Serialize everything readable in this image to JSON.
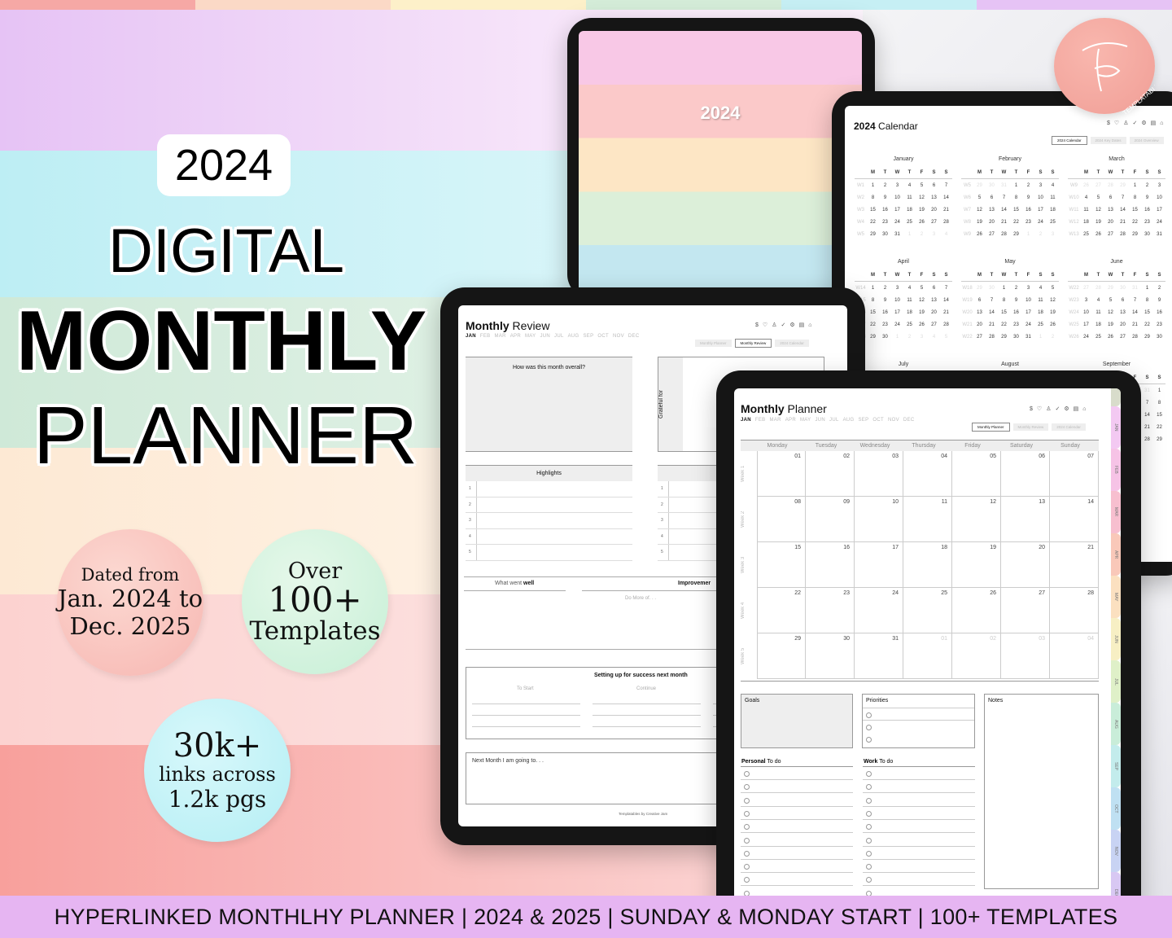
{
  "colors": {
    "purple": "#e6c3f5",
    "cyan": "#bdeef4",
    "green": "#d7eede",
    "peach": "#fdf0df",
    "pink": "#fcd6d4",
    "salmon": "#f8a9a5",
    "footer": "#e6b5f2"
  },
  "hero": {
    "year": "2024",
    "line1": "DIGITAL",
    "line2": "MONTHLY",
    "line3": "PLANNER"
  },
  "badges": {
    "dated": {
      "l1": "Dated from",
      "l2": "Jan. 2024 to",
      "l3": "Dec. 2025"
    },
    "templates": {
      "l1": "Over",
      "l2": "100+",
      "l3": "Templates"
    },
    "links": {
      "l1": "30k+",
      "l2": "links across",
      "l3": "1.2k pgs"
    }
  },
  "cover": {
    "year": "2024"
  },
  "logo": {
    "text": "TEMPLATABLES",
    "mark": "TF"
  },
  "nav": {
    "months": [
      "JAN",
      "FEB",
      "MAR",
      "APR",
      "MAY",
      "JUN",
      "JUL",
      "AUG",
      "SEP",
      "OCT",
      "NOV",
      "DEC"
    ],
    "icons": [
      "dollar-icon",
      "heart-icon",
      "person-icon",
      "check-circle-icon",
      "settings-icon",
      "book-icon",
      "home-icon"
    ]
  },
  "calendar": {
    "title_bold": "2024",
    "title_rest": " Calendar",
    "buttons": [
      "2024 Calendar",
      "2024 Key Dates",
      "2024 Overview"
    ],
    "weekdays": [
      "M",
      "T",
      "W",
      "T",
      "F",
      "S",
      "S"
    ],
    "months": [
      "January",
      "February",
      "March",
      "April",
      "May",
      "June",
      "July",
      "August",
      "September"
    ]
  },
  "review": {
    "title_bold": "Monthly",
    "title_rest": " Review",
    "buttons": [
      "Monthly Planner",
      "Monthly Review",
      "2024 Calendar"
    ],
    "overall": "How was this month overall?",
    "grateful": "Grateful for",
    "highlights": "Highlights",
    "numbers": [
      "1",
      "2",
      "3",
      "4",
      "5"
    ],
    "went_well_a": "What went ",
    "went_well_b": "well",
    "improvements": "Improvemer",
    "do_more": "Do More of. . .",
    "success": "Setting up for success next month",
    "to_start": "To Start",
    "continue": "Continue",
    "next_month": "Next Month I am going to. . .",
    "credit": "Templatables by Creative Jam"
  },
  "planner": {
    "title_bold": "Monthly",
    "title_rest": " Planner",
    "buttons": [
      "Monthly Planner",
      "Monthly Review",
      "2024 Calendar"
    ],
    "days": [
      "Monday",
      "Tuesday",
      "Wednesday",
      "Thursday",
      "Friday",
      "Saturday",
      "Sunday"
    ],
    "weeks": [
      "Week 1",
      "Week 2",
      "Week 3",
      "Week 4",
      "Week 5"
    ],
    "dates": [
      "01",
      "02",
      "03",
      "04",
      "05",
      "06",
      "07",
      "08",
      "09",
      "10",
      "11",
      "12",
      "13",
      "14",
      "15",
      "16",
      "17",
      "18",
      "19",
      "20",
      "21",
      "22",
      "23",
      "24",
      "25",
      "26",
      "27",
      "28",
      "29",
      "30",
      "31",
      "01",
      "02",
      "03",
      "04"
    ],
    "goals": "Goals",
    "priorities": "Priorities",
    "notes": "Notes",
    "personal_a": "Personal",
    "personal_b": " To do",
    "work_a": "Work",
    "work_b": " To do",
    "tabs": [
      {
        "label": "JAN",
        "color": "#f3c9f2"
      },
      {
        "label": "FEB",
        "color": "#f6c3e6"
      },
      {
        "label": "MAR",
        "color": "#f7bfcf"
      },
      {
        "label": "APR",
        "color": "#f9c8b9"
      },
      {
        "label": "MAY",
        "color": "#fbe0c0"
      },
      {
        "label": "JUN",
        "color": "#f7efc4"
      },
      {
        "label": "JUL",
        "color": "#dff0c8"
      },
      {
        "label": "AUG",
        "color": "#c9edd9"
      },
      {
        "label": "SEP",
        "color": "#c3ecec"
      },
      {
        "label": "OCT",
        "color": "#bfe0f2"
      },
      {
        "label": "NOV",
        "color": "#c8d3f3"
      },
      {
        "label": "DEC",
        "color": "#d8c8f3"
      }
    ]
  },
  "footer": {
    "text": "HYPERLINKED MONTHLHY PLANNER | 2024 & 2025 | SUNDAY & MONDAY START | 100+ TEMPLATES"
  }
}
